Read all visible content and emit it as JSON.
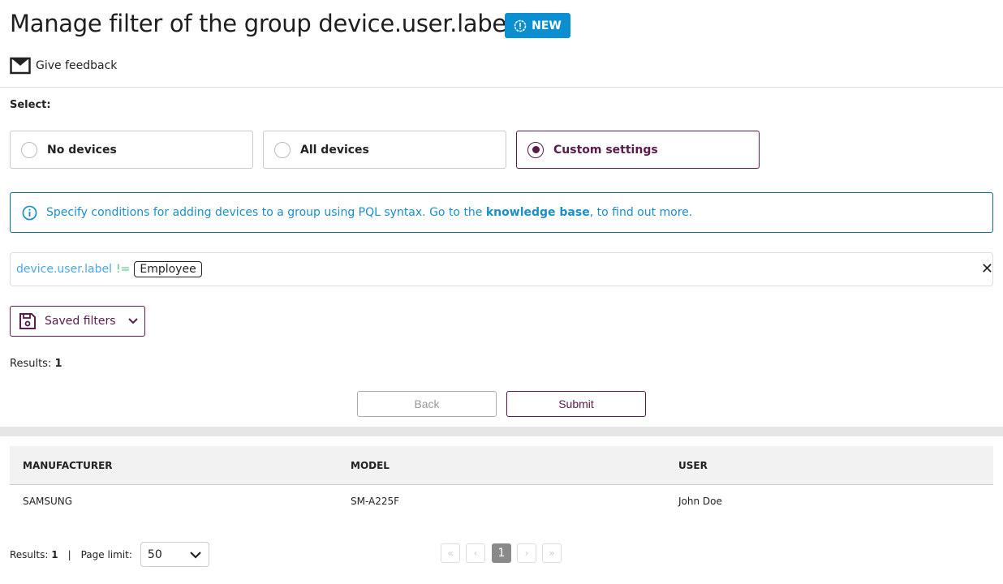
{
  "header": {
    "title": "Manage filter of the group device.user.label",
    "badge": "NEW",
    "feedback": "Give feedback"
  },
  "select": {
    "label": "Select:",
    "options": [
      {
        "label": "No devices",
        "selected": false
      },
      {
        "label": "All devices",
        "selected": false
      },
      {
        "label": "Custom settings",
        "selected": true
      }
    ]
  },
  "info": {
    "text_before": "Specify conditions for adding devices to a group using PQL syntax. Go to the ",
    "link": "knowledge base",
    "text_after": ", to find out more."
  },
  "query": {
    "field": "device.user.label",
    "operator": "!=",
    "value": "Employee"
  },
  "saved_filters": "Saved filters",
  "results": {
    "label": "Results:",
    "count": "1"
  },
  "buttons": {
    "back": "Back",
    "submit": "Submit"
  },
  "table": {
    "columns": [
      "MANUFACTURER",
      "MODEL",
      "USER"
    ],
    "rows": [
      [
        "SAMSUNG",
        "SM-A225F",
        "John Doe"
      ]
    ]
  },
  "footer": {
    "results_label": "Results:",
    "results_count": "1",
    "sep": "|",
    "page_limit_label": "Page limit:",
    "page_limit": "50",
    "pages": {
      "first": "«",
      "prev": "‹",
      "current": "1",
      "next": "›",
      "last": "»"
    }
  },
  "colors": {
    "accent": "#5a1a4a",
    "badge": "#0b8fd0",
    "info": "#1a8fc8"
  }
}
